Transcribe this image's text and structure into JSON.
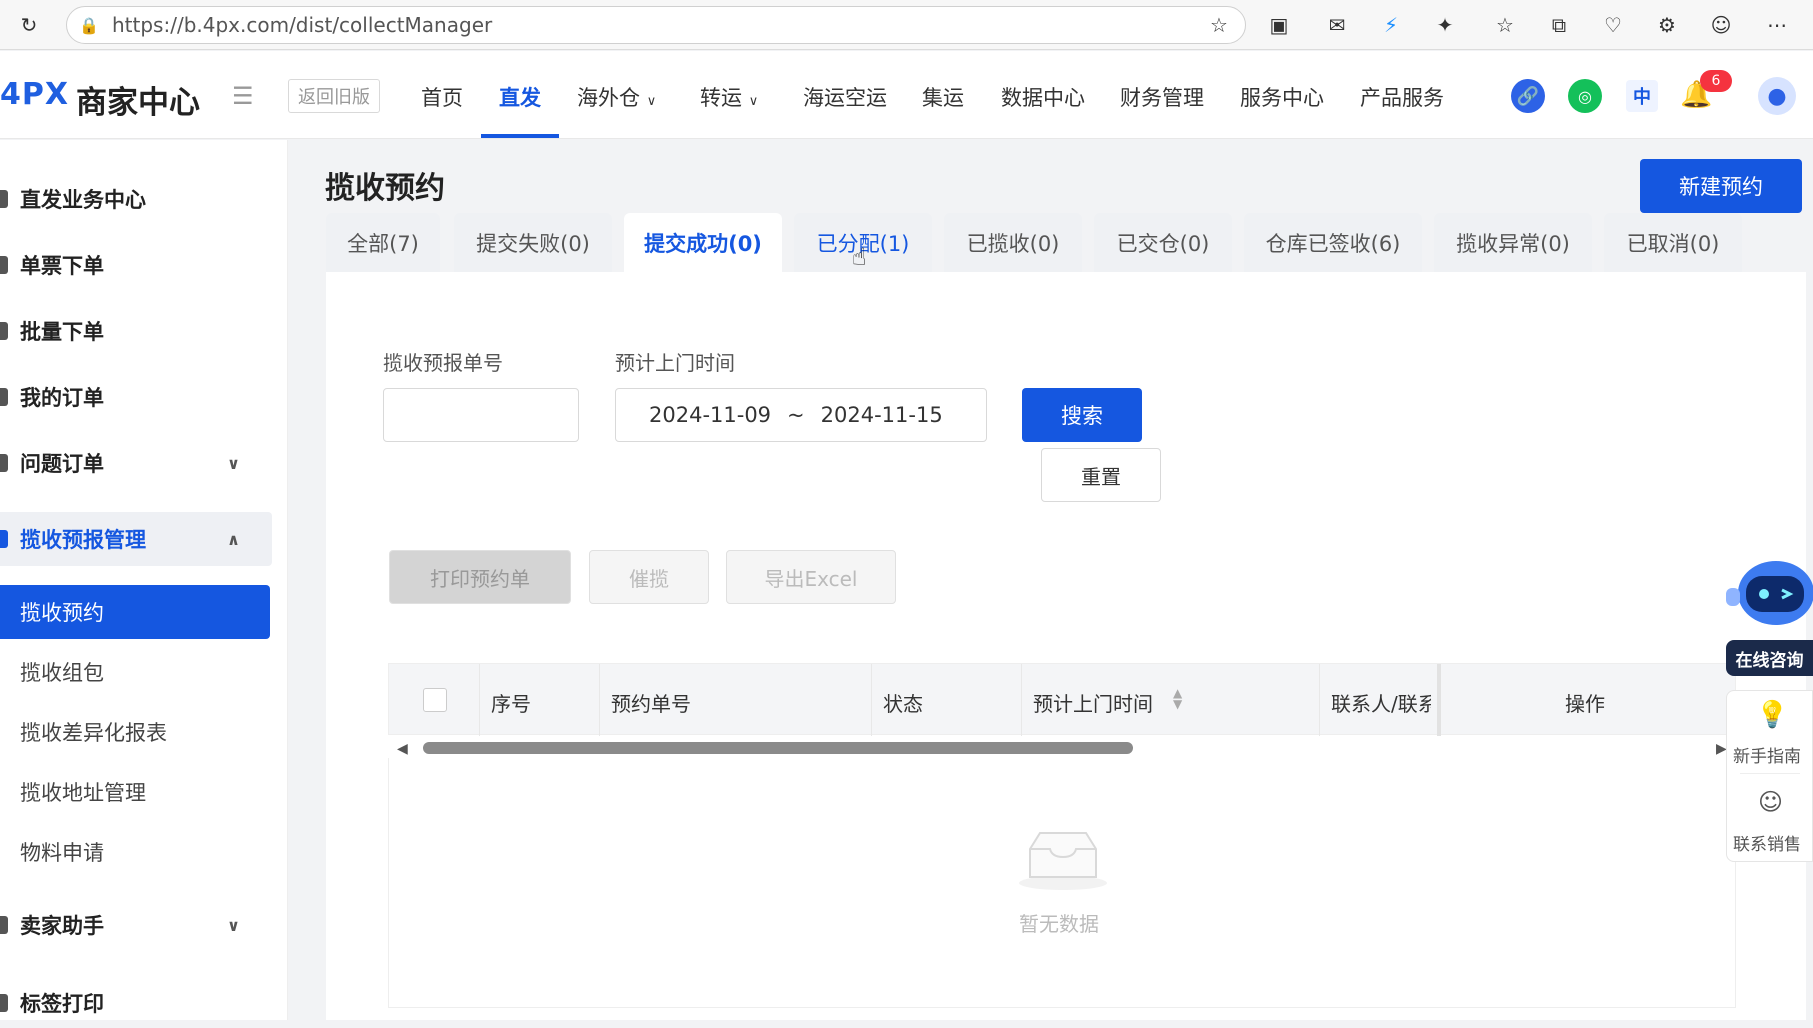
{
  "browser": {
    "url": "https://b.4px.com/dist/collectManager",
    "icons": [
      "reload-icon",
      "lock-icon",
      "star-icon",
      "extension-icon",
      "mail-icon",
      "bolt-icon",
      "puzzle-icon",
      "favorites-icon",
      "collections-icon",
      "performance-icon",
      "share-icon",
      "profile-avatar-icon",
      "more-icon"
    ]
  },
  "header": {
    "logo": "4PX",
    "brand": "商家中心",
    "old_version": "返回旧版",
    "nav": [
      {
        "label": "首页"
      },
      {
        "label": "直发",
        "active": true
      },
      {
        "label": "海外仓",
        "dropdown": true
      },
      {
        "label": "转运",
        "dropdown": true
      },
      {
        "label": "海运空运"
      },
      {
        "label": "集运"
      },
      {
        "label": "数据中心"
      },
      {
        "label": "财务管理"
      },
      {
        "label": "服务中心"
      },
      {
        "label": "产品服务"
      }
    ],
    "lang": "中",
    "notification_count": "6"
  },
  "sidebar": {
    "items": [
      {
        "label": "直发业务中心",
        "type": "group"
      },
      {
        "label": "单票下单",
        "type": "group"
      },
      {
        "label": "批量下单",
        "type": "group"
      },
      {
        "label": "我的订单",
        "type": "group"
      },
      {
        "label": "问题订单",
        "type": "group",
        "chevron": "down"
      },
      {
        "label": "揽收预报管理",
        "type": "group",
        "chevron": "up",
        "expanded": true
      },
      {
        "label": "揽收预约",
        "type": "sub",
        "active": true
      },
      {
        "label": "揽收组包",
        "type": "sub"
      },
      {
        "label": "揽收差异化报表",
        "type": "sub"
      },
      {
        "label": "揽收地址管理",
        "type": "sub"
      },
      {
        "label": "物料申请",
        "type": "sub"
      },
      {
        "label": "卖家助手",
        "type": "group",
        "chevron": "down"
      },
      {
        "label": "标签打印",
        "type": "group"
      }
    ]
  },
  "main": {
    "title": "揽收预约",
    "new_button": "新建预约",
    "tabs": [
      {
        "label": "全部(7)"
      },
      {
        "label": "提交失败(0)"
      },
      {
        "label": "提交成功(0)",
        "active": true
      },
      {
        "label": "已分配(1)",
        "hover": true
      },
      {
        "label": "已揽收(0)"
      },
      {
        "label": "已交仓(0)"
      },
      {
        "label": "仓库已签收(6)"
      },
      {
        "label": "揽收异常(0)"
      },
      {
        "label": "已取消(0)"
      }
    ],
    "filters": {
      "order_no_label": "揽收预报单号",
      "order_no_value": "",
      "time_label": "预计上门时间",
      "date_start": "2024-11-09",
      "date_sep": "~",
      "date_end": "2024-11-15",
      "search": "搜索",
      "reset": "重置"
    },
    "actions": {
      "print": "打印预约单",
      "urge": "催揽",
      "export": "导出Excel"
    },
    "table": {
      "columns": [
        "序号",
        "预约单号",
        "状态",
        "预计上门时间",
        "联系人/联系",
        "操作"
      ],
      "empty_text": "暂无数据"
    }
  },
  "assistant": {
    "consult": "在线咨询",
    "guide": "新手指南",
    "contact_sales": "联系销售"
  },
  "colors": {
    "primary": "#1557e0",
    "active_sidebar_bg": "#1557e0",
    "badge_red": "#f5333f"
  }
}
